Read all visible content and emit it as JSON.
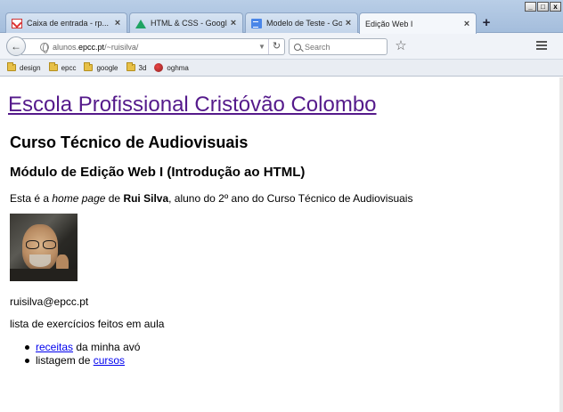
{
  "browser": {
    "tabs": [
      {
        "label": "Caixa de entrada - rp...",
        "icon": "gmail-icon"
      },
      {
        "label": "HTML & CSS - Google ...",
        "icon": "drive-icon"
      },
      {
        "label": "Modelo de Teste - Go...",
        "icon": "docs-icon"
      },
      {
        "label": "Edição Web I",
        "icon": "none"
      }
    ],
    "active_tab": 3,
    "url_prefix": "alunos.",
    "url_host": "epcc.pt",
    "url_path": "/~ruisilva/",
    "search_placeholder": "Search",
    "window_controls": {
      "minimize": "_",
      "restore": "□",
      "close": "x"
    },
    "bookmarks": [
      {
        "label": "design",
        "icon": "folder-icon"
      },
      {
        "label": "epcc",
        "icon": "folder-icon"
      },
      {
        "label": "google",
        "icon": "folder-icon"
      },
      {
        "label": "3d",
        "icon": "folder-icon"
      },
      {
        "label": "oghma",
        "icon": "oghma-icon"
      }
    ]
  },
  "page": {
    "title": "Escola Profissional Cristóvão Colombo",
    "course": "Curso Técnico de Audiovisuais",
    "module": "Módulo de Edição Web I (Introdução ao HTML)",
    "intro": {
      "part1": "Esta é a ",
      "italic": "home page",
      "part2": " de ",
      "bold": "Rui Silva",
      "part3": ", aluno do 2º ano do Curso Técnico de Audiovisuais"
    },
    "email": "ruisilva@epcc.pt",
    "list_title": "lista de exercícios feitos em aula",
    "exercises": [
      {
        "link": "receitas",
        "text": " da minha avó"
      },
      {
        "prefix": "listagem de ",
        "link": "cursos"
      }
    ]
  },
  "colors": {
    "visited_link": "#551a8b",
    "link": "#0000ee"
  }
}
